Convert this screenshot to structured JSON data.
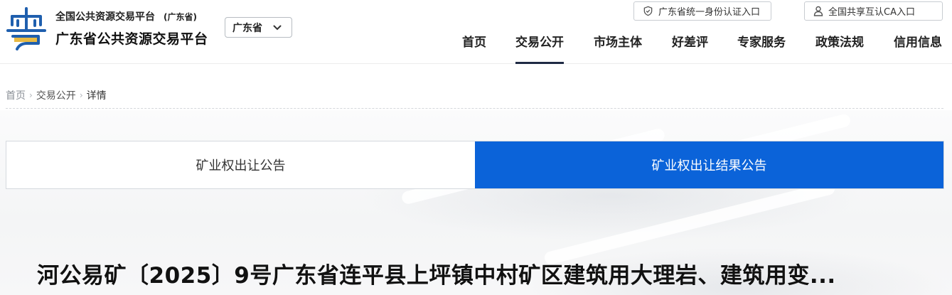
{
  "header": {
    "logo_line1": "全国公共资源交易平台",
    "logo_line1_suffix": "(广东省)",
    "logo_line2": "广东省公共资源交易平台",
    "region_select": "广东省",
    "auth_links": [
      {
        "label": "广东省统一身份认证入口",
        "icon": "shield-icon"
      },
      {
        "label": "全国共享互认CA入口",
        "icon": "user-icon"
      }
    ],
    "nav": [
      "首页",
      "交易公开",
      "市场主体",
      "好差评",
      "专家服务",
      "政策法规",
      "信用信息"
    ],
    "nav_active": "交易公开"
  },
  "breadcrumb": [
    "首页",
    "交易公开",
    "详情"
  ],
  "tabs": [
    {
      "label": "矿业权出让公告",
      "active": false
    },
    {
      "label": "矿业权出让结果公告",
      "active": true
    }
  ],
  "title": "河公易矿〔2025〕9号广东省连平县上坪镇中村矿区建筑用大理岩、建筑用变...",
  "colors": {
    "accent": "#0b63d9",
    "nav_underline": "#1f2a44",
    "logo_blue": "#1f5fae"
  }
}
